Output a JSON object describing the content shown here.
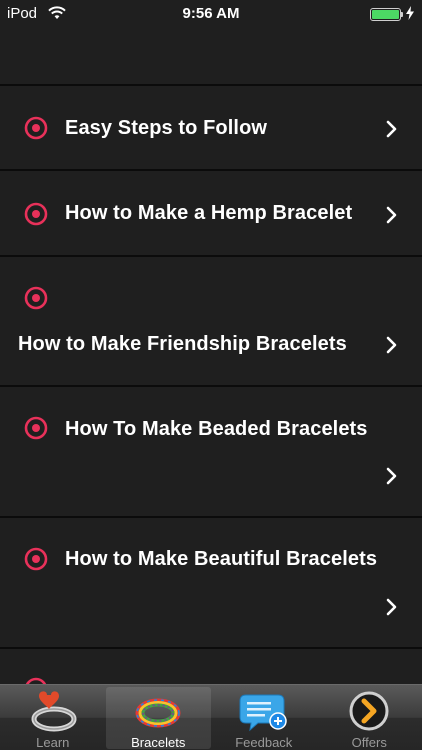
{
  "status_bar": {
    "carrier": "iPod",
    "time": "9:56 AM"
  },
  "list": {
    "items": [
      {
        "label": "Easy Steps to Follow"
      },
      {
        "label": "How to Make a Hemp Bracelet"
      },
      {
        "label": "How to Make Friendship Bracelets"
      },
      {
        "label": "How To Make Beaded Bracelets"
      },
      {
        "label": "How to Make Beautiful Bracelets"
      }
    ]
  },
  "tab_bar": {
    "tabs": [
      {
        "label": "Learn",
        "icon": "ring-heart-icon"
      },
      {
        "label": "Bracelets",
        "icon": "rainbow-bracelet-icon",
        "selected": true
      },
      {
        "label": "Feedback",
        "icon": "feedback-bubble-icon"
      },
      {
        "label": "Offers",
        "icon": "offers-chevron-icon"
      }
    ]
  },
  "colors": {
    "accent": "#e8315a",
    "background": "#1f1f1f",
    "separator": "#0b0b0b",
    "battery": "#4cd964"
  }
}
